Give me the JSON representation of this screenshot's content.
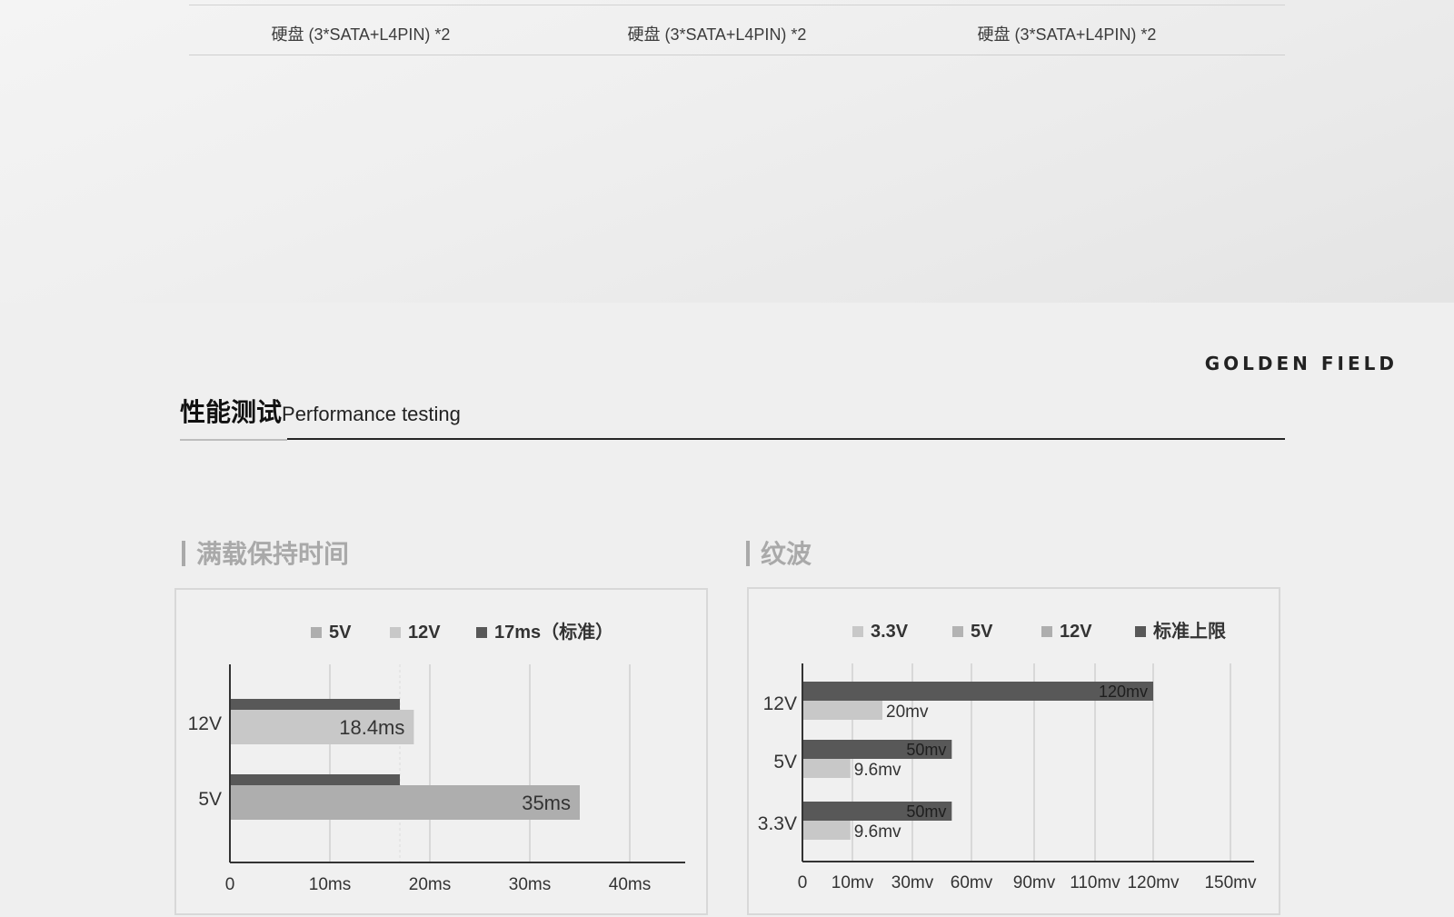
{
  "spec_row": {
    "cells": [
      "硬盘 (3*SATA+L4PIN) *2",
      "硬盘 (3*SATA+L4PIN) *2",
      "硬盘 (3*SATA+L4PIN) *2"
    ]
  },
  "brand": "GOLDEN FIELD",
  "section": {
    "title_cn": "性能测试",
    "title_en": "Performance testing"
  },
  "colors": {
    "dark": "#585858",
    "light": "#c8c8c8",
    "mid": "#aeaeae",
    "legend_mid": "#b3b3b3",
    "axis": "#333333",
    "grid": "#cfcfcf"
  },
  "chart_data": [
    {
      "type": "bar",
      "orientation": "horizontal",
      "title": "满载保持时间",
      "categories": [
        "12V",
        "5V"
      ],
      "series": [
        {
          "name": "5V",
          "values": [
            null,
            35
          ],
          "labels": [
            "",
            "35ms"
          ]
        },
        {
          "name": "12V",
          "values": [
            18.4,
            null
          ],
          "labels": [
            "18.4ms",
            ""
          ]
        },
        {
          "name": "17ms（标准）",
          "values": [
            17,
            17
          ],
          "labels": [
            "",
            ""
          ]
        }
      ],
      "xlim": [
        0,
        45
      ],
      "xticks": [
        0,
        10,
        20,
        30,
        40
      ],
      "xtick_labels": [
        "0",
        "10ms",
        "20ms",
        "30ms",
        "40ms"
      ],
      "grid": true,
      "legend": "top"
    },
    {
      "type": "bar",
      "orientation": "horizontal",
      "title": "纹波",
      "categories": [
        "12V",
        "5V",
        "3.3V"
      ],
      "series": [
        {
          "name": "3.3V",
          "values": [
            null,
            null,
            9.6
          ],
          "labels": [
            "",
            "",
            "9.6mv"
          ]
        },
        {
          "name": "5V",
          "values": [
            null,
            9.6,
            null
          ],
          "labels": [
            "",
            "9.6mv",
            ""
          ]
        },
        {
          "name": "12V",
          "values": [
            20,
            null,
            null
          ],
          "labels": [
            "20mv",
            "",
            ""
          ]
        },
        {
          "name": "标准上限",
          "values": [
            120,
            50,
            50
          ],
          "labels": [
            "120mv",
            "50mv",
            "50mv"
          ]
        }
      ],
      "xtick_labels": [
        "0",
        "10mv",
        "30mv",
        "60mv",
        "90mv",
        "110mv",
        "120mv",
        "150mv"
      ],
      "scale": "non-linear (ticks evenly placed per label)",
      "grid": true,
      "legend": "top"
    }
  ]
}
